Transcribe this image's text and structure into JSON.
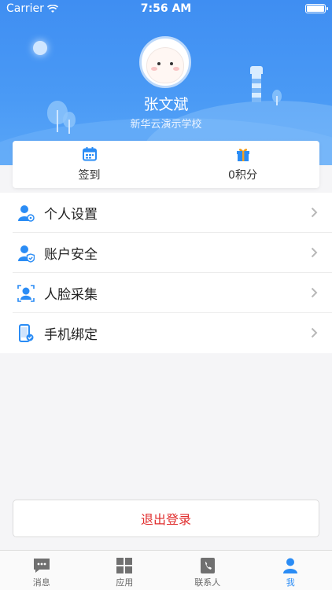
{
  "status_bar": {
    "carrier": "Carrier",
    "time": "7:56 AM"
  },
  "profile": {
    "name": "张文斌",
    "school": "新华云演示学校"
  },
  "quick": {
    "checkin_label": "签到",
    "points_label": "0积分"
  },
  "menu": [
    {
      "label": "个人设置",
      "icon": "user-settings-icon"
    },
    {
      "label": "账户安全",
      "icon": "account-security-icon"
    },
    {
      "label": "人脸采集",
      "icon": "face-capture-icon"
    },
    {
      "label": "手机绑定",
      "icon": "phone-bind-icon"
    }
  ],
  "logout_label": "退出登录",
  "tabs": [
    {
      "label": "消息",
      "icon": "message-icon"
    },
    {
      "label": "应用",
      "icon": "apps-grid-icon"
    },
    {
      "label": "联系人",
      "icon": "contacts-icon"
    },
    {
      "label": "我",
      "icon": "me-icon"
    }
  ],
  "colors": {
    "accent": "#2a8cf5",
    "danger": "#e02e2e",
    "header": "#4a9af5"
  }
}
